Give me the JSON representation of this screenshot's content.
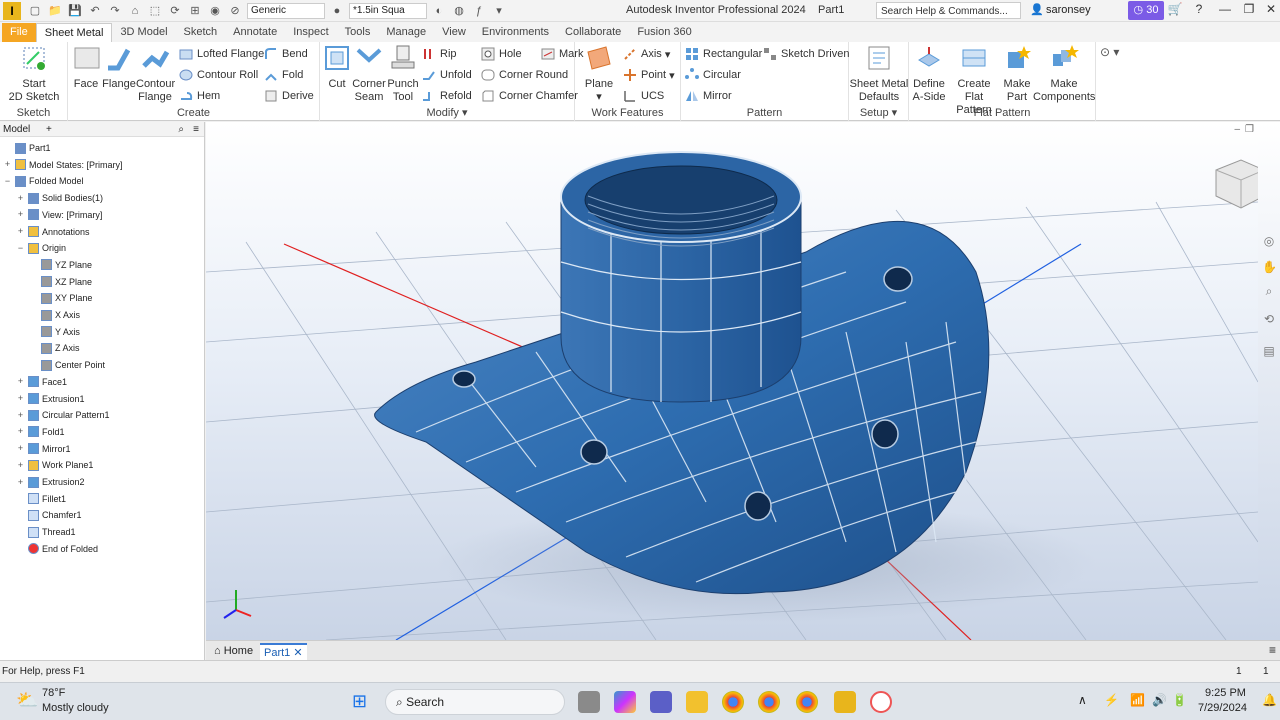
{
  "titlebar": {
    "app_logo": "I",
    "appearance_value": "Generic",
    "material_value": "*1.5in Squa",
    "title": "Autodesk Inventor Professional 2024",
    "doc": "Part1",
    "search_placeholder": "Search Help & Commands...",
    "user": "saronsey",
    "clock_badge": "30"
  },
  "tabs": [
    "File",
    "Sheet Metal",
    "3D Model",
    "Sketch",
    "Annotate",
    "Inspect",
    "Tools",
    "Manage",
    "View",
    "Environments",
    "Collaborate",
    "Fusion 360"
  ],
  "ribbon": {
    "sketch": {
      "label": "Sketch",
      "start": "Start",
      "start2": "2D Sketch"
    },
    "create": {
      "label": "Create",
      "face": "Face",
      "flange": "Flange",
      "contour": "Contour",
      "contour2": "Flange",
      "lofted": "Lofted Flange",
      "contour_roll": "Contour Roll",
      "hem": "Hem",
      "bend": "Bend",
      "fold": "Fold",
      "derive": "Derive"
    },
    "modify": {
      "label": "Modify",
      "cut": "Cut",
      "corner": "Corner",
      "seam": "Seam",
      "punch": "Punch",
      "tool": "Tool",
      "rip": "Rip",
      "unfold": "Unfold",
      "refold": "Refold",
      "hole": "Hole",
      "corner_round": "Corner Round",
      "corner_chamfer": "Corner Chamfer",
      "mark": "Mark"
    },
    "work": {
      "label": "Work Features",
      "plane": "Plane",
      "axis": "Axis",
      "point": "Point",
      "ucs": "UCS"
    },
    "pattern": {
      "label": "Pattern",
      "rectangular": "Rectangular",
      "circular": "Circular",
      "mirror": "Mirror",
      "sketch_driven": "Sketch Driven"
    },
    "setup": {
      "label": "Setup",
      "defaults": "Sheet Metal",
      "defaults2": "Defaults"
    },
    "flat": {
      "label": "Flat Pattern",
      "define": "Define",
      "define2": "A-Side",
      "create": "Create",
      "create2": "Flat Pattern",
      "make_part": "Make",
      "make_part2": "Part",
      "make_comp": "Make",
      "make_comp2": "Components"
    }
  },
  "browser": {
    "title": "Model",
    "plus": "+",
    "items": [
      {
        "label": "Part1",
        "exp": ""
      },
      {
        "label": "Model States: [Primary]",
        "exp": "+"
      },
      {
        "label": "Folded Model",
        "exp": "−"
      },
      {
        "label": "Solid Bodies(1)",
        "exp": "+"
      },
      {
        "label": "View: [Primary]",
        "exp": "+"
      },
      {
        "label": "Annotations",
        "exp": "+"
      },
      {
        "label": "Origin",
        "exp": "−"
      },
      {
        "label": "YZ Plane",
        "exp": ""
      },
      {
        "label": "XZ Plane",
        "exp": ""
      },
      {
        "label": "XY Plane",
        "exp": ""
      },
      {
        "label": "X Axis",
        "exp": ""
      },
      {
        "label": "Y Axis",
        "exp": ""
      },
      {
        "label": "Z Axis",
        "exp": ""
      },
      {
        "label": "Center Point",
        "exp": ""
      },
      {
        "label": "Face1",
        "exp": "+"
      },
      {
        "label": "Extrusion1",
        "exp": "+"
      },
      {
        "label": "Circular Pattern1",
        "exp": "+"
      },
      {
        "label": "Fold1",
        "exp": "+"
      },
      {
        "label": "Mirror1",
        "exp": "+"
      },
      {
        "label": "Work Plane1",
        "exp": "+"
      },
      {
        "label": "Extrusion2",
        "exp": "+"
      },
      {
        "label": "Fillet1",
        "exp": ""
      },
      {
        "label": "Chamfer1",
        "exp": ""
      },
      {
        "label": "Thread1",
        "exp": ""
      },
      {
        "label": "End of Folded",
        "exp": ""
      }
    ]
  },
  "doctabs": {
    "home": "Home",
    "part": "Part1"
  },
  "status": {
    "help": "For Help, press F1",
    "n1": "1",
    "n2": "1"
  },
  "taskbar": {
    "weather_temp": "78°F",
    "weather_desc": "Mostly cloudy",
    "search": "Search",
    "time": "9:25 PM",
    "date": "7/29/2024"
  },
  "colors": {
    "accent_file": "#f5a623",
    "model_blue": "#2e6db0",
    "badge": "#7b5be6"
  }
}
